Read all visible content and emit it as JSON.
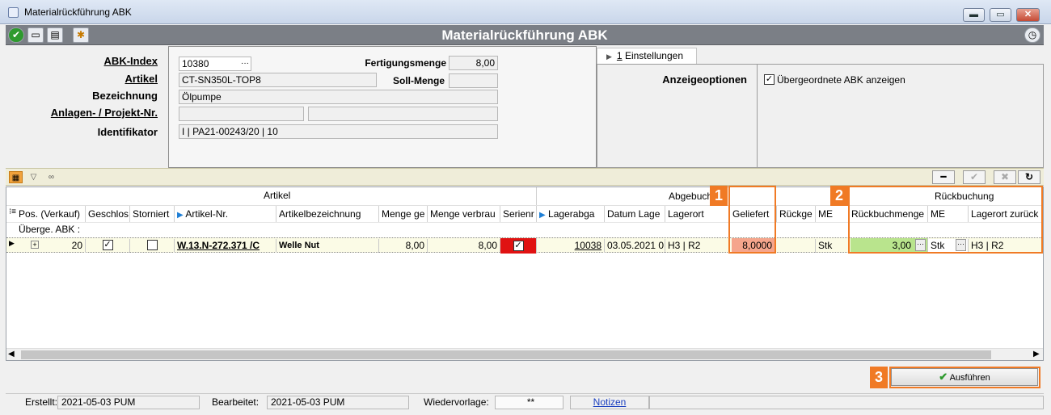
{
  "window": {
    "title": "Materialrückführung ABK",
    "header_title": "Materialrückführung ABK",
    "controls": {
      "minimize": "▬",
      "restore": "▭",
      "close": "✕"
    }
  },
  "toolbar_icons": [
    "check-icon",
    "window-icon",
    "document-icon",
    "magnifier-icon"
  ],
  "form": {
    "abk_index_label": "ABK-Index",
    "abk_index_value": "10380",
    "abk_index_btn": "···",
    "artikel_label": "Artikel",
    "artikel_value": "CT-SN350L-TOP8",
    "bezeichnung_label": "Bezeichnung",
    "bezeichnung_value": "Ölpumpe",
    "anlagen_label": "Anlagen- / Projekt-Nr.",
    "anlagen_value1": "",
    "anlagen_value2": "",
    "identifikator_label": "Identifikator",
    "identifikator_value": "I | PA21-00243/20 | 10",
    "fertigungsmenge_label": "Fertigungsmenge",
    "fertigungsmenge_value": "8,00",
    "sollmenge_label": "Soll-Menge",
    "sollmenge_value": ""
  },
  "settings": {
    "tab_arrow": "▶",
    "tab_key": "1",
    "tab_label": " Einstellungen",
    "anzeigeoptionen_label": "Anzeigeoptionen",
    "checkbox_label": "Übergeordnete ABK anzeigen",
    "checkbox_checked": "✓"
  },
  "grid_toolbar": {
    "minus": "━",
    "check": "✔",
    "cross": "✖",
    "refresh": "↻"
  },
  "grid": {
    "group_headers": {
      "artikel": "Artikel",
      "abgebuchung": "Abgebuch",
      "rueckbuchung": "Rückbuchung"
    },
    "columns": [
      "Pos. (Verkauf)",
      "Geschlos",
      "Storniert",
      "Artikel-Nr.",
      "Artikelbezeichnung",
      "Menge ge",
      "Menge verbrau",
      "Serienr",
      "Lagerabga",
      "Datum Lage",
      "Lagerort",
      "Geliefert",
      "Rückge",
      "ME",
      "Rückbuchmenge",
      "ME",
      "Lagerort zurück"
    ],
    "group_row_label": "Überge. ABK :",
    "row": {
      "pos": "20",
      "geschlossen": "✓",
      "storniert": "",
      "artikel_nr": "W.13.N-272.371 /C",
      "bezeichnung": "Welle Nut",
      "menge_ge": "8,00",
      "menge_verbraucht": "8,00",
      "serien": "✓",
      "lagerabgang": "10038",
      "datum": "03.05.2021 0",
      "lagerort": "H3 | R2",
      "geliefert": "8,0000",
      "rueckgegeben": "",
      "me": "Stk",
      "rueckbuchmenge": "3,00",
      "me2": "Stk",
      "lagerort_zurueck": "H3 | R2"
    }
  },
  "badges": [
    "1",
    "2",
    "3"
  ],
  "execute_button": "Ausführen",
  "status": {
    "erstellt_label": "Erstellt:",
    "erstellt_value": "2021-05-03  PUM",
    "bearbeitet_label": "Bearbeitet:",
    "bearbeitet_value": "2021-05-03  PUM",
    "wiedervorlage_label": "Wiedervorlage:",
    "wiedervorlage_value": "**",
    "notizen_label": "Notizen"
  },
  "colors": {
    "highlight": "#f07a25",
    "serien_red": "#e01212",
    "geliefert_bg": "#f5a58c",
    "rueckbuch_bg": "#b9e48d"
  }
}
